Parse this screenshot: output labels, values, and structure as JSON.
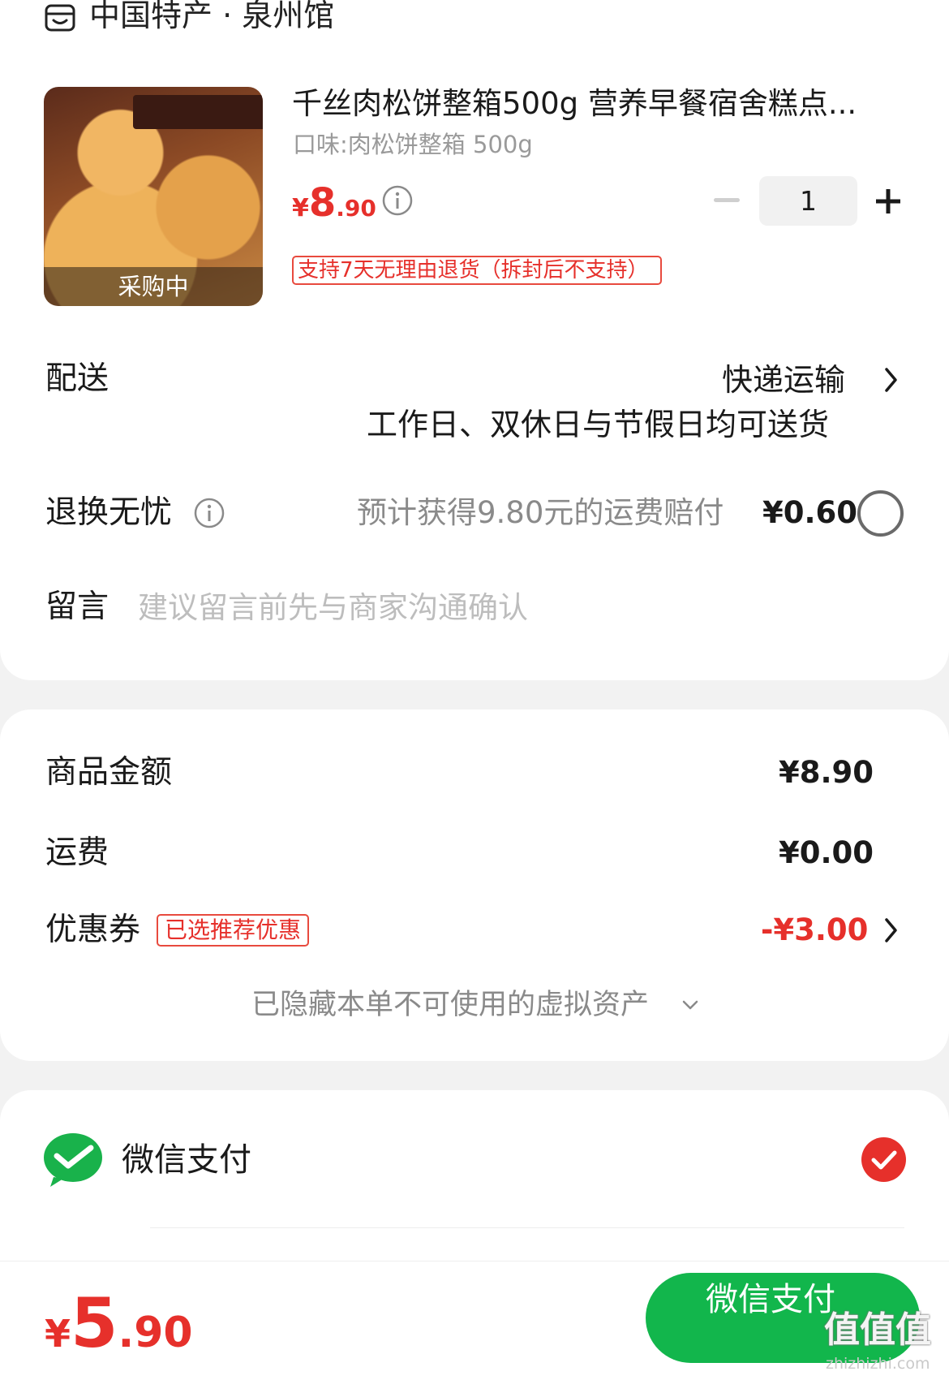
{
  "shop": {
    "icon": "shop-icon",
    "name": "中国特产 · 泉州馆"
  },
  "product": {
    "image_label": "采购中",
    "title": "千丝肉松饼整箱500g 营养早餐宿舍糕点...",
    "spec": "口味:肉松饼整箱 500g",
    "price_symbol": "¥",
    "price_int": "8",
    "price_dec": ".90",
    "quantity": "1",
    "return_policy": "支持7天无理由退货（拆封后不支持）"
  },
  "delivery": {
    "label": "配送",
    "method": "快递运输",
    "note": "工作日、双休日与节假日均可送货"
  },
  "worry_free": {
    "label": "退换无忧",
    "desc": "预计获得9.80元的运费赔付",
    "price": "¥0.60"
  },
  "message": {
    "label": "留言",
    "placeholder": "建议留言前先与商家沟通确认"
  },
  "summary": {
    "subtotal_label": "商品金额",
    "subtotal_value": "¥8.90",
    "shipping_label": "运费",
    "shipping_value": "¥0.00",
    "coupon_label": "优惠券",
    "coupon_tag": "已选推荐优惠",
    "coupon_value": "-¥3.00",
    "hidden_assets": "已隐藏本单不可使用的虚拟资产"
  },
  "payment": {
    "method_label": "微信支付",
    "selected": true,
    "colors": {
      "accent_red": "#e6302b",
      "wechat_green": "#12b64c"
    }
  },
  "footer": {
    "total_symbol": "¥",
    "total_int": "5",
    "total_dec": ".90",
    "pay_button": "微信支付",
    "watermark": "值值值",
    "watermark_url": "zhizhizhi.com"
  }
}
